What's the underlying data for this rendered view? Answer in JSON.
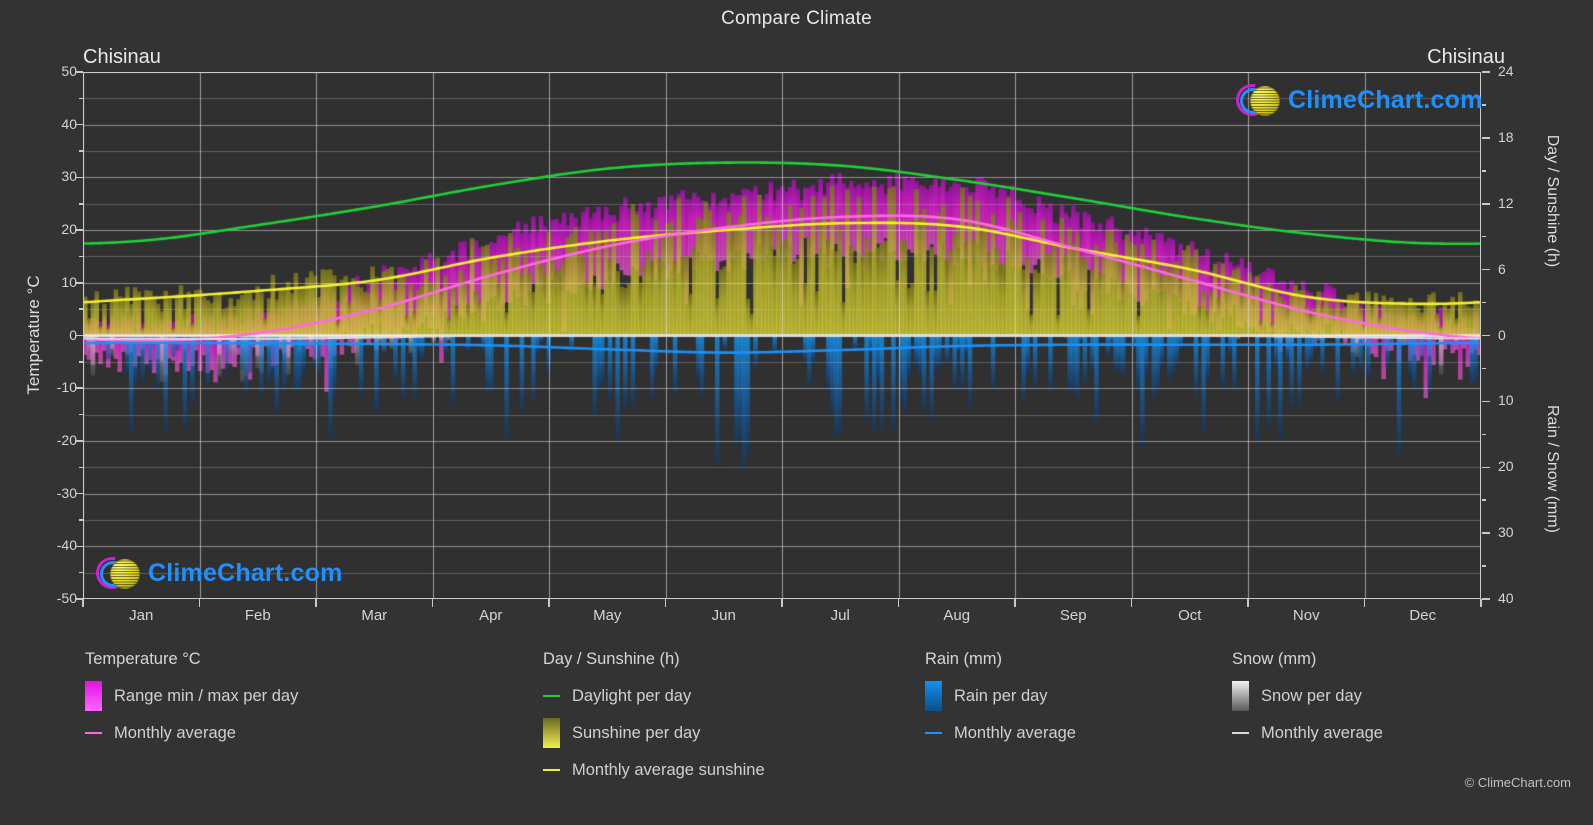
{
  "title": "Compare Climate",
  "city_left": "Chisinau",
  "city_right": "Chisinau",
  "copyright": "© ClimeChart.com",
  "logo": {
    "text": "ClimeChart.com",
    "text_color": "#1e90ff",
    "arc_color": "#cc22cc",
    "ball_color": "#d6cf20"
  },
  "axes": {
    "left": {
      "label": "Temperature °C",
      "ticks": [
        "50",
        "40",
        "30",
        "20",
        "10",
        "0",
        "-10",
        "-20",
        "-30",
        "-40",
        "-50"
      ],
      "min": -50,
      "max": 50,
      "step": 10
    },
    "right_top": {
      "label": "Day / Sunshine (h)",
      "ticks": [
        "24",
        "18",
        "12",
        "6",
        "0"
      ],
      "min": 0,
      "max": 24,
      "step": 6
    },
    "right_bottom": {
      "label": "Rain / Snow (mm)",
      "ticks": [
        "0",
        "10",
        "20",
        "30",
        "40"
      ],
      "min": 0,
      "max": 40,
      "step": 10
    },
    "x": {
      "ticks": [
        "Jan",
        "Feb",
        "Mar",
        "Apr",
        "May",
        "Jun",
        "Jul",
        "Aug",
        "Sep",
        "Oct",
        "Nov",
        "Dec"
      ]
    }
  },
  "legend": {
    "groups": [
      {
        "title": "Temperature °C",
        "items": [
          {
            "label": "Range min / max per day",
            "style": "box",
            "color": "#e312e3",
            "color2": "#ff66ff"
          },
          {
            "label": "Monthly average",
            "style": "line",
            "color": "#ff66dd"
          }
        ]
      },
      {
        "title": "Day / Sunshine (h)",
        "items": [
          {
            "label": "Daylight per day",
            "style": "line",
            "color": "#22cc33"
          },
          {
            "label": "Sunshine per day",
            "style": "box",
            "color": "#6b6a1e",
            "color2": "#f2ef50"
          },
          {
            "label": "Monthly average sunshine",
            "style": "line",
            "color": "#f2ef3a"
          }
        ]
      },
      {
        "title": "Rain (mm)",
        "items": [
          {
            "label": "Rain per day",
            "style": "box",
            "color": "#1192ee",
            "color2": "#0b4f8a"
          },
          {
            "label": "Monthly average",
            "style": "line",
            "color": "#1e90ff"
          }
        ]
      },
      {
        "title": "Snow (mm)",
        "items": [
          {
            "label": "Snow per day",
            "style": "box",
            "color": "#f2f2f2",
            "color2": "#5a5a5a"
          },
          {
            "label": "Monthly average",
            "style": "line",
            "color": "#d8d8d8"
          }
        ]
      }
    ]
  },
  "chart_data": {
    "type": "line",
    "title": "Compare Climate",
    "subtitle": "Chisinau",
    "xlabel": "",
    "ylabel": "Temperature °C",
    "y2label_top": "Day / Sunshine (h)",
    "y2label_bottom": "Rain / Snow (mm)",
    "ylim": [
      -50,
      50
    ],
    "y2lim_top": [
      0,
      24
    ],
    "y2lim_bottom": [
      0,
      40
    ],
    "grid": true,
    "legend_position": "below",
    "categories": [
      "Jan",
      "Feb",
      "Mar",
      "Apr",
      "May",
      "Jun",
      "Jul",
      "Aug",
      "Sep",
      "Oct",
      "Nov",
      "Dec"
    ],
    "series": [
      {
        "name": "Daylight per day",
        "unit": "h",
        "color": "#22cc33",
        "axis": "right_top",
        "values": [
          8.8,
          10.2,
          11.9,
          13.7,
          15.2,
          15.9,
          15.6,
          14.3,
          12.6,
          10.8,
          9.3,
          8.5
        ],
        "values_as_temp_scale": [
          18.0,
          21.0,
          24.5,
          28.5,
          31.7,
          32.8,
          32.2,
          29.5,
          26.0,
          22.3,
          19.3,
          17.5
        ]
      },
      {
        "name": "Monthly average sunshine",
        "unit": "h",
        "color": "#f2ef3a",
        "axis": "right_top",
        "values": [
          3.3,
          4.0,
          5.0,
          7.1,
          8.7,
          9.6,
          10.3,
          10.0,
          7.9,
          6.0,
          3.5,
          2.9
        ],
        "values_as_temp_scale": [
          7.0,
          8.5,
          10.5,
          14.8,
          18.0,
          20.0,
          21.3,
          20.7,
          16.5,
          12.5,
          7.3,
          6.0
        ]
      },
      {
        "name": "Monthly average temperature",
        "unit": "°C",
        "color": "#ff66dd",
        "axis": "left",
        "values": [
          -1.0,
          0.5,
          5.0,
          11.5,
          17.0,
          20.5,
          22.5,
          22.0,
          16.5,
          10.5,
          4.5,
          0.5
        ]
      },
      {
        "name": "Rain monthly average",
        "unit": "mm",
        "color": "#1e90ff",
        "axis": "right_bottom",
        "values": [
          1.1,
          1.2,
          1.3,
          1.5,
          2.1,
          2.6,
          2.2,
          1.6,
          1.4,
          1.4,
          1.4,
          1.2
        ]
      },
      {
        "name": "Snow monthly average",
        "unit": "mm",
        "color": "#d8d8d8",
        "axis": "right_bottom",
        "values": [
          0.5,
          0.5,
          0.3,
          0.0,
          0.0,
          0.0,
          0.0,
          0.0,
          0.0,
          0.0,
          0.2,
          0.4
        ]
      }
    ],
    "bands": [
      {
        "name": "Range min / max per day",
        "color": "#e312e3",
        "axis": "left",
        "min": [
          -5.0,
          -4.0,
          0.0,
          5.5,
          11.0,
          14.5,
          16.5,
          15.5,
          11.0,
          5.5,
          0.5,
          -3.0
        ],
        "max": [
          2.5,
          4.5,
          10.5,
          18.0,
          23.5,
          26.5,
          28.5,
          28.5,
          22.5,
          16.0,
          8.5,
          3.5
        ]
      },
      {
        "name": "Sunshine per day",
        "color": "#d0cc3a",
        "axis": "right_top",
        "values": [
          3.3,
          4.0,
          5.0,
          7.1,
          8.7,
          9.6,
          10.3,
          10.0,
          7.9,
          6.0,
          3.5,
          2.9
        ]
      },
      {
        "name": "Rain per day",
        "color": "#1192ee",
        "axis": "right_bottom",
        "values": [
          1.1,
          1.2,
          1.3,
          1.5,
          2.1,
          2.6,
          2.2,
          1.6,
          1.4,
          1.4,
          1.4,
          1.2
        ]
      },
      {
        "name": "Snow per day",
        "color": "#bcbcbc",
        "axis": "right_bottom",
        "values": [
          0.6,
          0.6,
          0.3,
          0.0,
          0.0,
          0.0,
          0.0,
          0.0,
          0.0,
          0.0,
          0.2,
          0.5
        ]
      }
    ]
  }
}
